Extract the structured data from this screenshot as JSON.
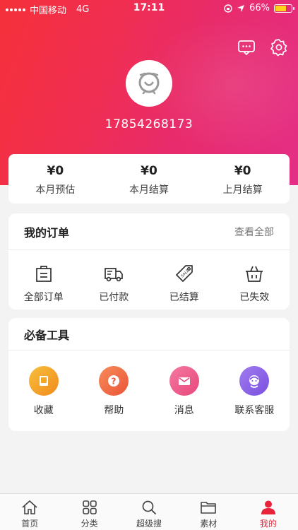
{
  "status_bar": {
    "carrier": "中国移动",
    "network": "4G",
    "time": "17:11",
    "battery": "66%",
    "battery_level": 0.66
  },
  "profile": {
    "phone": "17854268173"
  },
  "stats": [
    {
      "value": "¥0",
      "label": "本月预估"
    },
    {
      "value": "¥0",
      "label": "本月结算"
    },
    {
      "value": "¥0",
      "label": "上月结算"
    }
  ],
  "orders": {
    "title": "我的订单",
    "view_all": "查看全部",
    "items": [
      {
        "label": "全部订单",
        "icon": "bag-icon"
      },
      {
        "label": "已付款",
        "icon": "truck-icon"
      },
      {
        "label": "已结算",
        "icon": "sale-tag-icon"
      },
      {
        "label": "已失效",
        "icon": "basket-icon"
      }
    ]
  },
  "tools": {
    "title": "必备工具",
    "items": [
      {
        "label": "收藏",
        "icon": "book-icon",
        "color": "#f5a623"
      },
      {
        "label": "帮助",
        "icon": "question-icon",
        "color": "#f26d4a"
      },
      {
        "label": "消息",
        "icon": "envelope-icon",
        "color": "#ee5a8c"
      },
      {
        "label": "联系客服",
        "icon": "support-agent-icon",
        "color": "#8a63e6"
      }
    ]
  },
  "tabbar": [
    {
      "label": "首页",
      "icon": "home-icon"
    },
    {
      "label": "分类",
      "icon": "grid-icon"
    },
    {
      "label": "超级搜",
      "icon": "search-icon"
    },
    {
      "label": "素材",
      "icon": "folder-icon"
    },
    {
      "label": "我的",
      "icon": "user-icon",
      "active": true
    }
  ],
  "colors": {
    "accent": "#e8243b",
    "hero_start": "#f5303a",
    "hero_end": "#e42e86"
  }
}
